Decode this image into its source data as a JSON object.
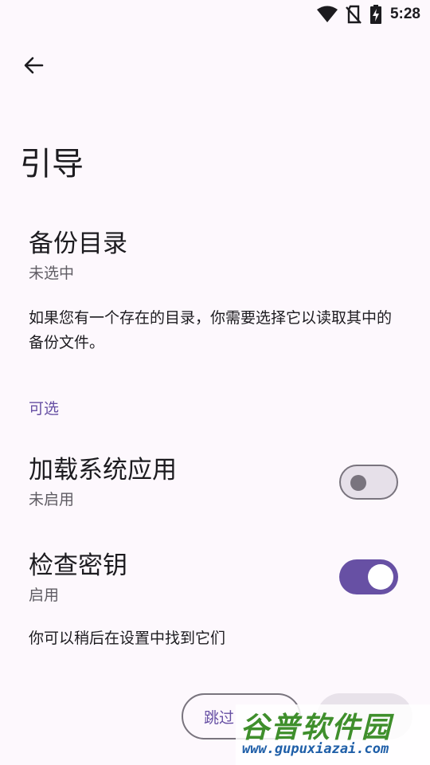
{
  "status_bar": {
    "time": "5:28"
  },
  "header": {
    "title": "引导"
  },
  "backup_dir": {
    "title": "备份目录",
    "status": "未选中",
    "description": "如果您有一个存在的目录，你需要选择它以读取其中的备份文件。"
  },
  "optional": {
    "category_label": "可选"
  },
  "load_system_apps": {
    "title": "加载系统应用",
    "status": "未启用",
    "enabled": false
  },
  "check_keys": {
    "title": "检查密钥",
    "status": "启用",
    "enabled": true
  },
  "footer": {
    "hint": "你可以稍后在设置中找到它们",
    "skip_label": "跳过"
  },
  "watermark": {
    "brand": "谷普软件园",
    "url": "www.gupuxiazai.com"
  },
  "colors": {
    "accent": "#6750a4",
    "background": "#fdf8fd"
  }
}
